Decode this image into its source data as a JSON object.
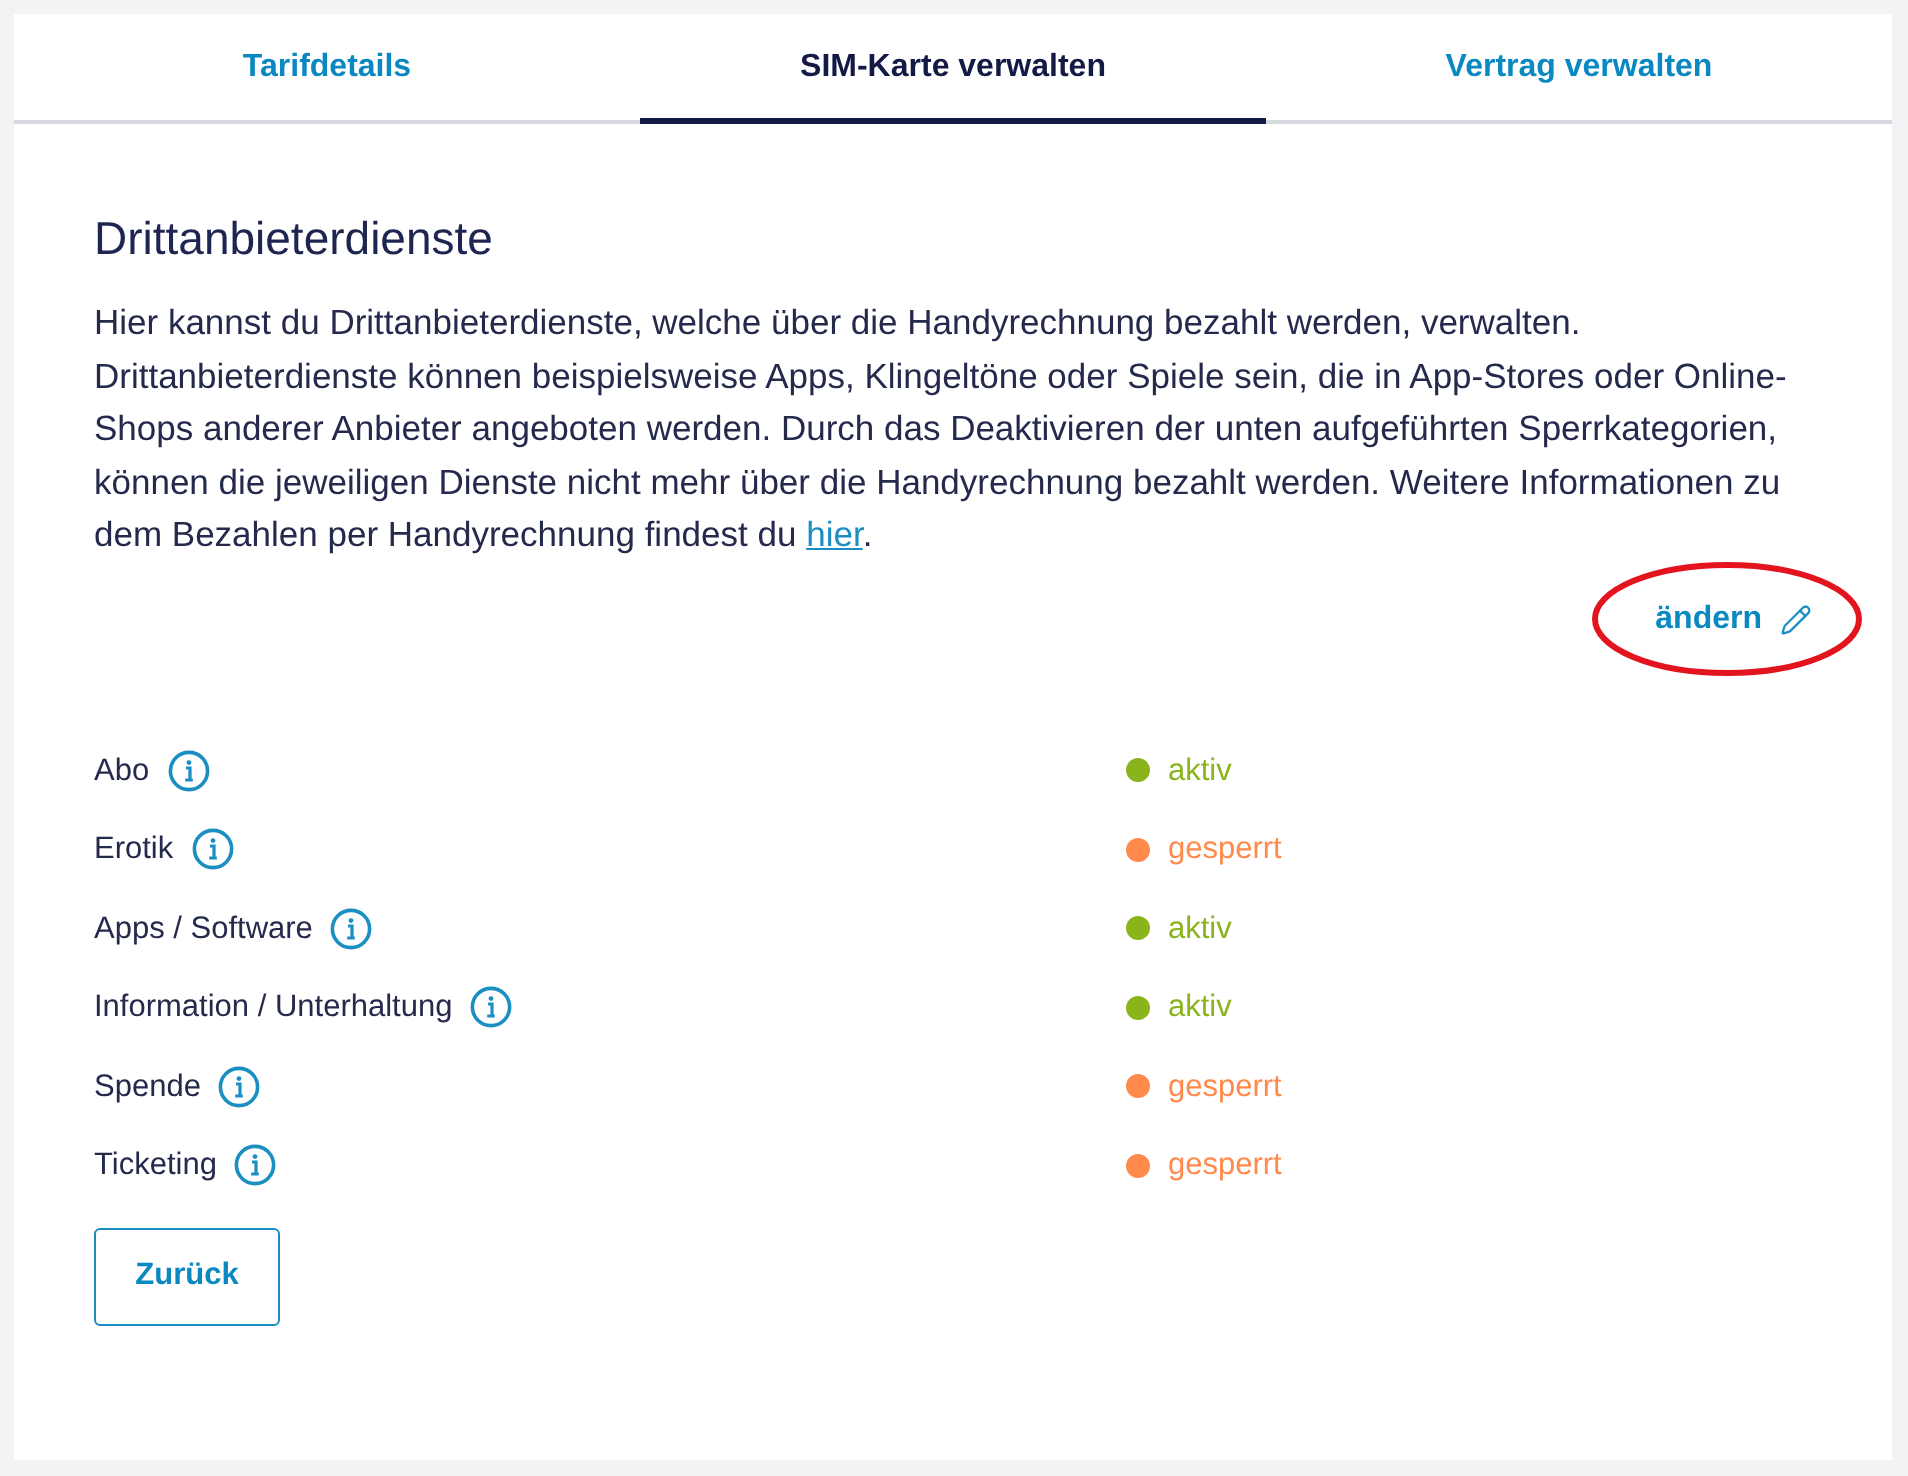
{
  "tabs": [
    {
      "label": "Tarifdetails",
      "selected": false
    },
    {
      "label": "SIM-Karte verwalten",
      "selected": true
    },
    {
      "label": "Vertrag verwalten",
      "selected": false
    }
  ],
  "section": {
    "title": "Drittanbieterdienste",
    "description": "Hier kannst du Drittanbieterdienste, welche über die Handyrechnung bezahlt werden, verwalten. Drittanbieterdienste können beispielsweise Apps, Klingeltöne oder Spiele sein, die in App-Stores oder Online-Shops anderer Anbieter angeboten werden. Durch das Deaktivieren der unten aufgeführten Sperrkategorien, können die jeweiligen Dienste nicht mehr über die Handyrechnung bezahlt werden. Weitere Informationen zu dem Bezahlen per Handyrechnung findest du",
    "link": "hier",
    "description_end": "."
  },
  "edit_link": {
    "label": "ändern",
    "highlighted": true
  },
  "categories": [
    {
      "name": "Abo",
      "status": "aktiv",
      "color": "#8ab41c"
    },
    {
      "name": "Erotik",
      "status": "gesperrt",
      "color": "#ff8a4c"
    },
    {
      "name": "Apps / Software",
      "status": "aktiv",
      "color": "#8ab41c"
    },
    {
      "name": "Information / Unterhaltung",
      "status": "aktiv",
      "color": "#8ab41c"
    },
    {
      "name": "Spende",
      "status": "gesperrt",
      "color": "#ff8a4c"
    },
    {
      "name": "Ticketing",
      "status": "gesperrt",
      "color": "#ff8a4c"
    }
  ],
  "back_button": "Zurück"
}
